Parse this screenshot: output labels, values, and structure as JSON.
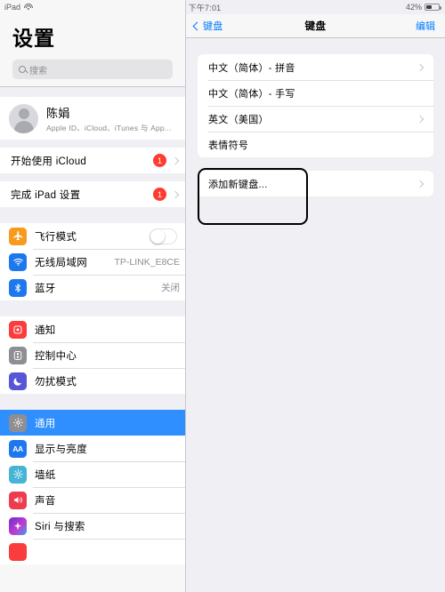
{
  "status_bar": {
    "device": "iPad",
    "wifi_icon": "wifi-icon",
    "time": "下午7:01",
    "battery_percent": "42%",
    "battery_level": 42
  },
  "sidebar": {
    "title": "设置",
    "search": {
      "placeholder": "搜索",
      "icon": "search-icon",
      "value": ""
    },
    "profile": {
      "name": "陈娟",
      "subtitle": "Apple ID、iCloud、iTunes 与 App...",
      "avatar_icon": "person-avatar-icon"
    },
    "setup_items": [
      {
        "label": "开始使用 iCloud",
        "badge": "1"
      },
      {
        "label": "完成 iPad 设置",
        "badge": "1"
      }
    ],
    "network_items": [
      {
        "label": "飞行模式",
        "icon": "airplane-icon",
        "color": "#f89a1e",
        "control": "toggle",
        "toggle_on": false
      },
      {
        "label": "无线局域网",
        "icon": "wifi-icon",
        "color": "#1d78ef",
        "value": "TP-LINK_E8CE"
      },
      {
        "label": "蓝牙",
        "icon": "bluetooth-icon",
        "color": "#1d78ef",
        "value": "关闭"
      }
    ],
    "system_items": [
      {
        "label": "通知",
        "icon": "notification-icon",
        "color": "#fa3c3c"
      },
      {
        "label": "控制中心",
        "icon": "control-center-icon",
        "color": "#8e8e93"
      },
      {
        "label": "勿扰模式",
        "icon": "moon-icon",
        "color": "#5756d6"
      }
    ],
    "general_items": [
      {
        "label": "通用",
        "icon": "gear-icon",
        "color": "#8e8e93",
        "selected": true
      },
      {
        "label": "显示与亮度",
        "icon": "display-aa-icon",
        "color": "#1d78ef",
        "selected": false
      },
      {
        "label": "墙纸",
        "icon": "wallpaper-icon",
        "color": "#46b4d4",
        "selected": false
      },
      {
        "label": "声音",
        "icon": "sound-icon",
        "color": "#ef3b50",
        "selected": false
      },
      {
        "label": "Siri 与搜索",
        "icon": "siri-icon",
        "color": "#5a37c0",
        "selected": false
      },
      {
        "label": "",
        "icon": "app-icon",
        "color": "#fa3c3c",
        "selected": false
      }
    ]
  },
  "detail": {
    "nav": {
      "back_label": "键盘",
      "back_icon": "chevron-left-icon",
      "title": "键盘",
      "edit_label": "编辑"
    },
    "keyboards": [
      {
        "label": "中文（简体）- 拼音",
        "chevron": true
      },
      {
        "label": "中文（简体）- 手写",
        "chevron": false
      },
      {
        "label": "英文（美国）",
        "chevron": true
      },
      {
        "label": "表情符号",
        "chevron": false
      }
    ],
    "add_keyboard": {
      "label": "添加新键盘...",
      "chevron": true,
      "highlighted": true
    }
  },
  "colors": {
    "accent": "#007aff",
    "selection": "#2f8fff",
    "badge": "#ff3b30",
    "background": "#efeff4",
    "annotation_outline": "#000000"
  }
}
